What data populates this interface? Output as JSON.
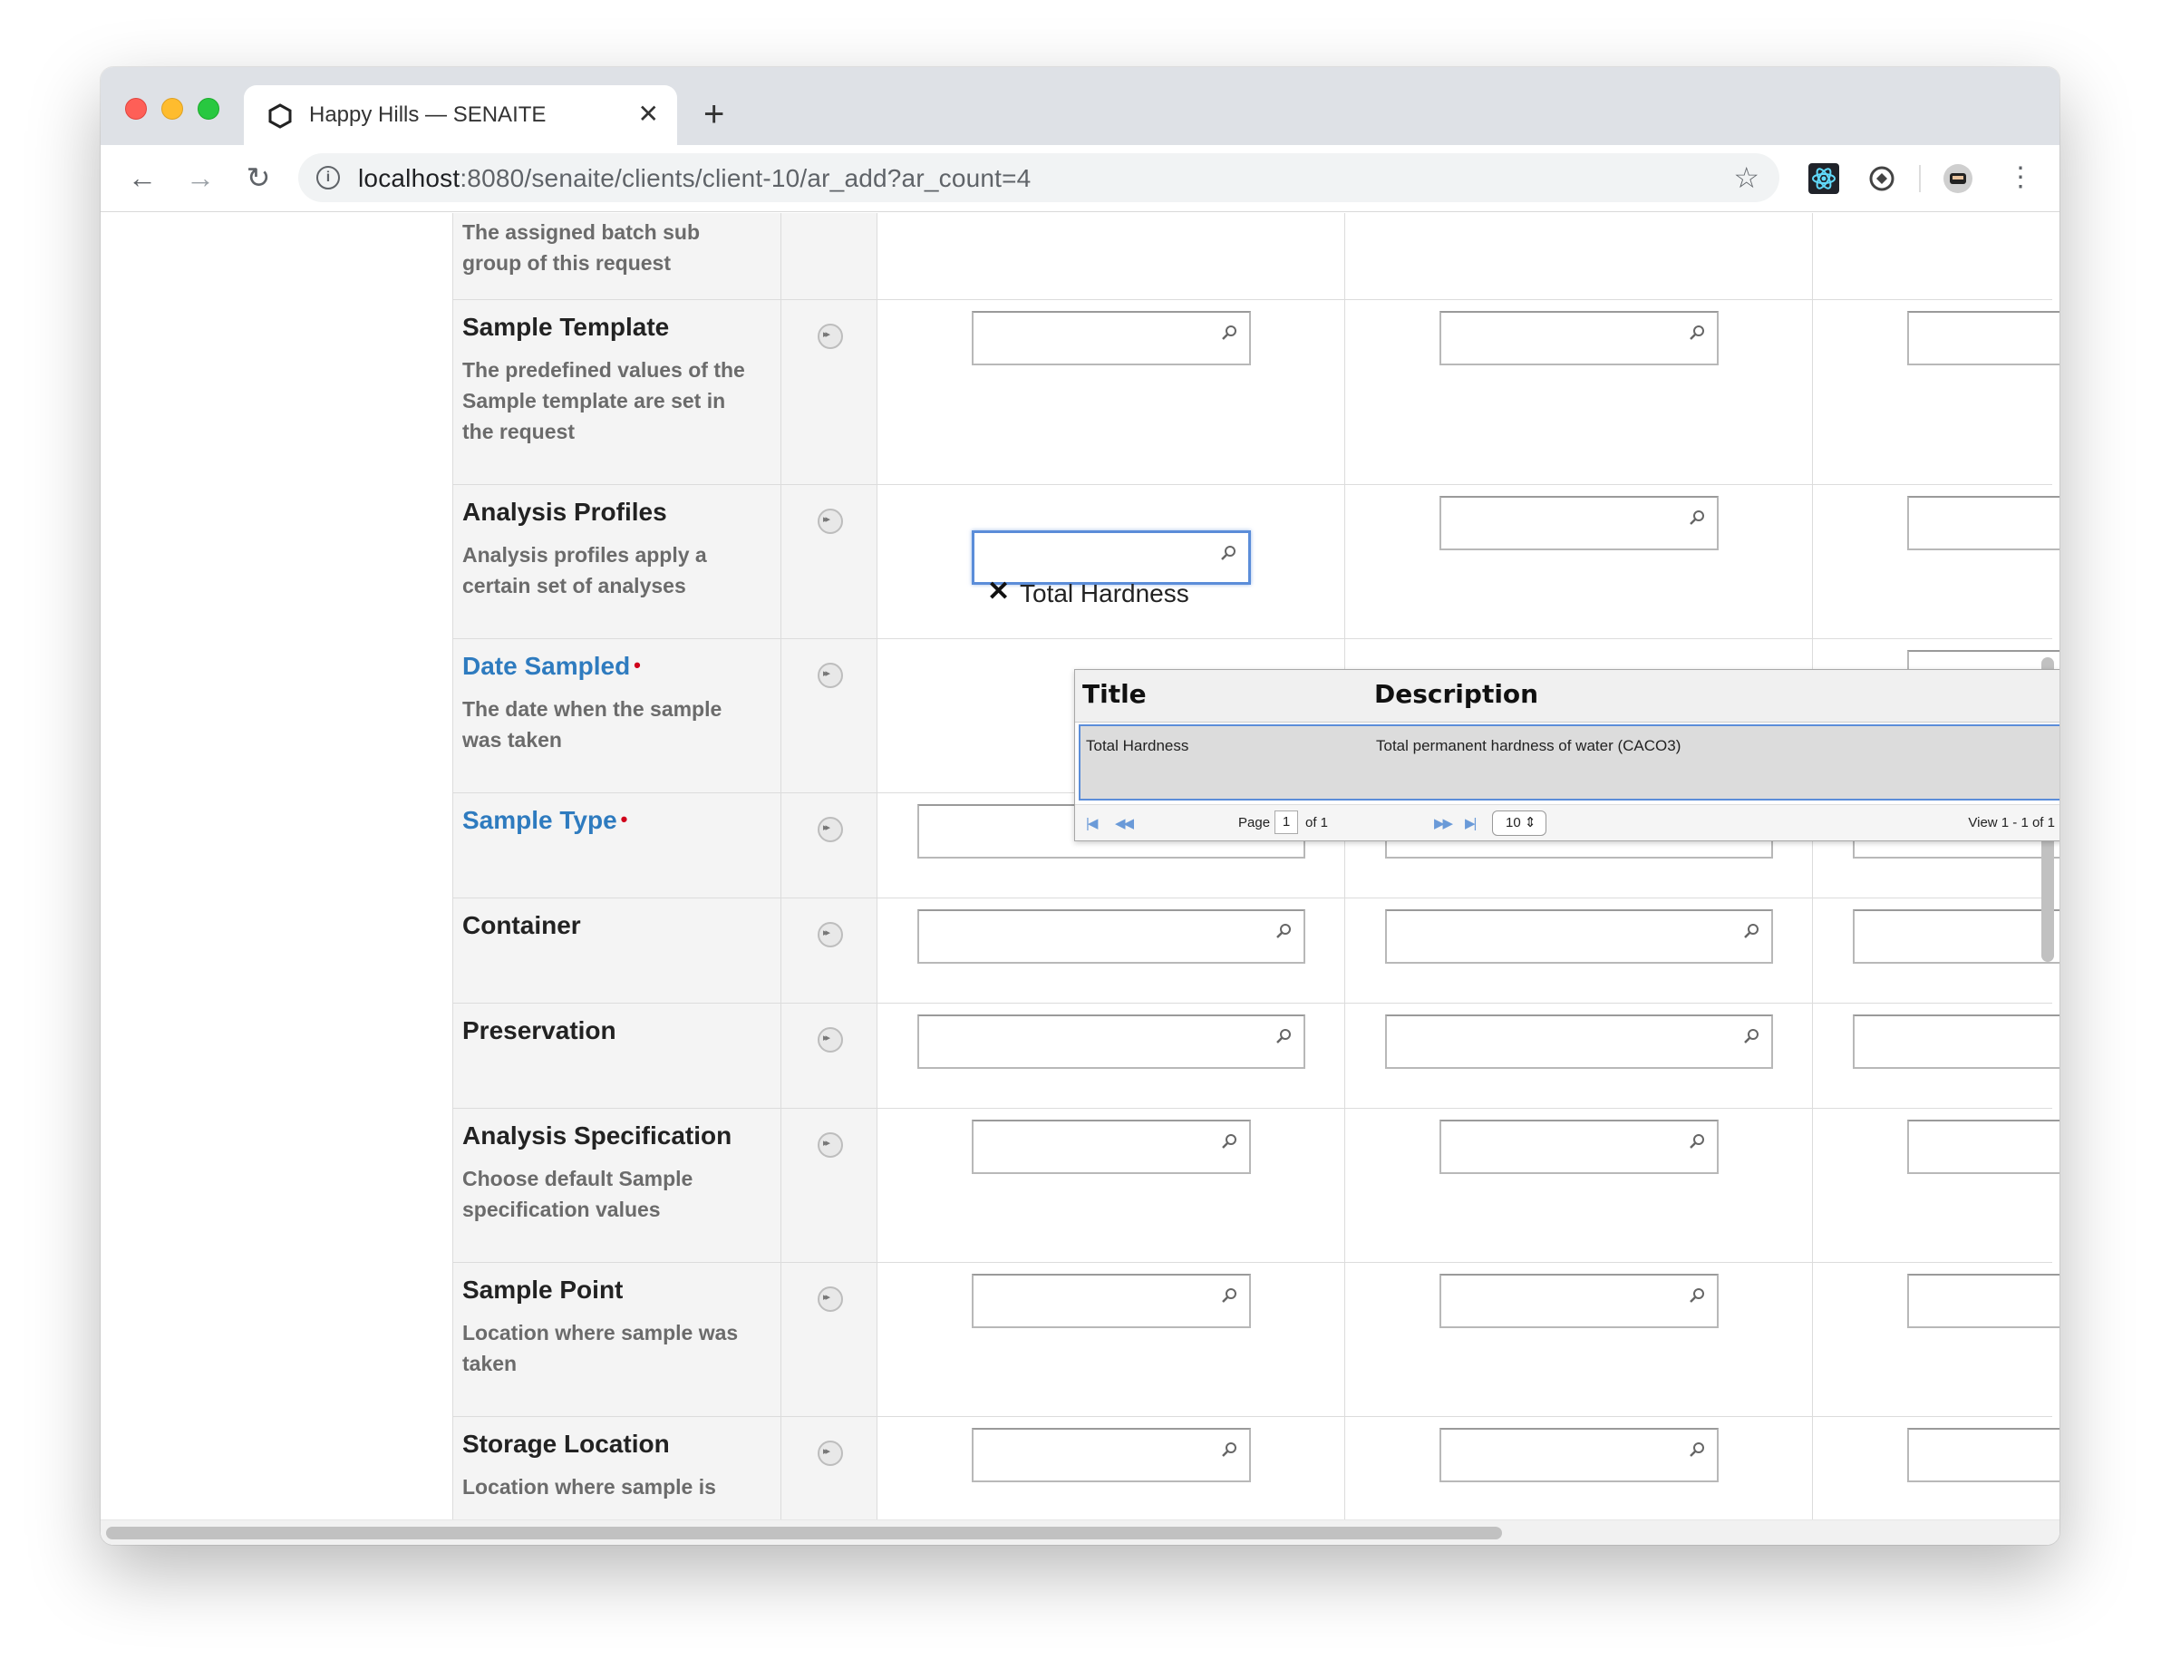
{
  "browser": {
    "tab_title": "Happy Hills — SENAITE",
    "url_host": "localhost",
    "url_rest": ":8080/senaite/clients/client-10/ar_add?ar_count=4"
  },
  "form": {
    "batch_sub_group_desc": "The assigned batch sub group of this request",
    "sample_template": {
      "label": "Sample Template",
      "desc": "The predefined values of the Sample template are set in the request"
    },
    "analysis_profiles": {
      "label": "Analysis Profiles",
      "desc": "Analysis profiles apply a certain set of analyses",
      "selected": "Total Hardness"
    },
    "date_sampled": {
      "label": "Date Sampled",
      "desc": "The date when the sample was taken",
      "required_mark": "•"
    },
    "sample_type": {
      "label": "Sample Type",
      "required_mark": "•"
    },
    "container": {
      "label": "Container"
    },
    "preservation": {
      "label": "Preservation"
    },
    "analysis_specification": {
      "label": "Analysis Specification",
      "desc": "Choose default Sample specification values"
    },
    "sample_point": {
      "label": "Sample Point",
      "desc": "Location where sample was taken"
    },
    "storage_location": {
      "label": "Storage Location",
      "desc": "Location where sample is"
    }
  },
  "popup": {
    "col_title": "Title",
    "col_description": "Description",
    "rows": [
      {
        "title": "Total Hardness",
        "description": "Total permanent hardness of water (CACO3)"
      }
    ],
    "pager": {
      "page_label": "Page",
      "page": "1",
      "of": "of 1",
      "page_size": "10",
      "view": "View 1 - 1 of 1"
    }
  },
  "colors": {
    "accent": "#2e7bbf",
    "required": "#d0021b",
    "focus": "#5b8dd9"
  }
}
